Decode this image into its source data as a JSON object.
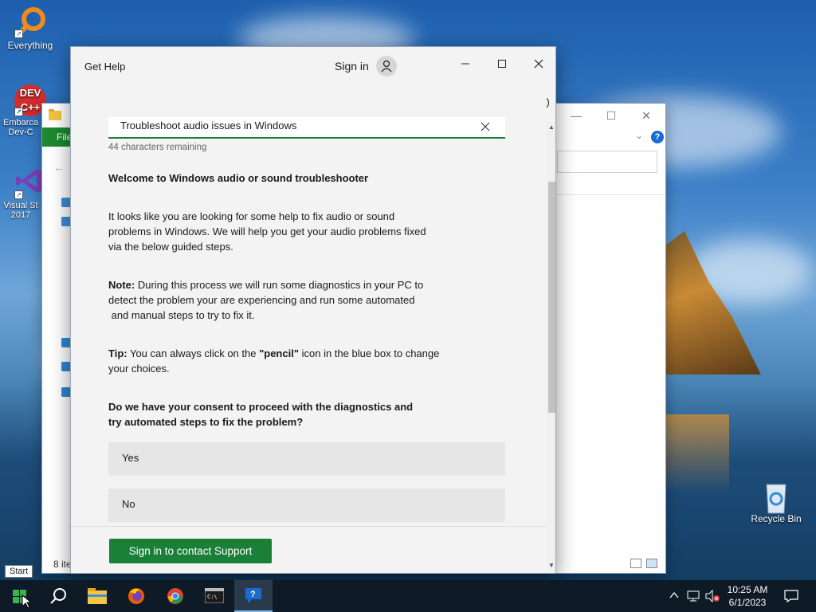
{
  "desktop": {
    "icons": [
      {
        "label": "Everything"
      },
      {
        "label": "Embarca Dev-C"
      },
      {
        "label": "Visual St 2017"
      },
      {
        "label": "Recycle Bin"
      }
    ]
  },
  "explorer": {
    "ribbon_tab": "File",
    "status": "8 ite",
    "help_label": "?"
  },
  "gethelp": {
    "title": "Get Help",
    "sign_in": "Sign in",
    "query": "Troubleshoot audio issues in Windows",
    "chars_remaining": "44 characters remaining",
    "heading": "Welcome to Windows audio or sound troubleshooter",
    "intro_lines": [
      "It looks like you are looking for some help to fix audio or sound",
      "problems in Windows. We will help you get your audio problems fixed",
      "via the below guided steps."
    ],
    "note_label": "Note:",
    "note_lines": [
      " During this process we will run some diagnostics in your PC to",
      "detect the problem your are experiencing and run some automated",
      " and manual steps to try to fix it."
    ],
    "tip_label": "Tip:",
    "tip_pre": " You can always click on the ",
    "tip_pencil": "\"pencil\"",
    "tip_post": " icon in the blue box to change",
    "tip_line2": "your choices.",
    "consent_lines": [
      "Do we have your consent to proceed with the diagnostics and",
      "try automated steps to fix the problem?"
    ],
    "choices": [
      "Yes",
      "No"
    ],
    "contact_button": "Sign in to contact Support",
    "accent_color": "#1a7f37"
  },
  "tooltip": {
    "start": "Start"
  },
  "taskbar": {
    "apps": [
      "start-icon",
      "search-icon",
      "file-explorer-icon",
      "firefox-icon",
      "chrome-icon",
      "terminal-icon",
      "get-help-icon"
    ],
    "time": "10:25 AM",
    "date": "6/1/2023"
  }
}
